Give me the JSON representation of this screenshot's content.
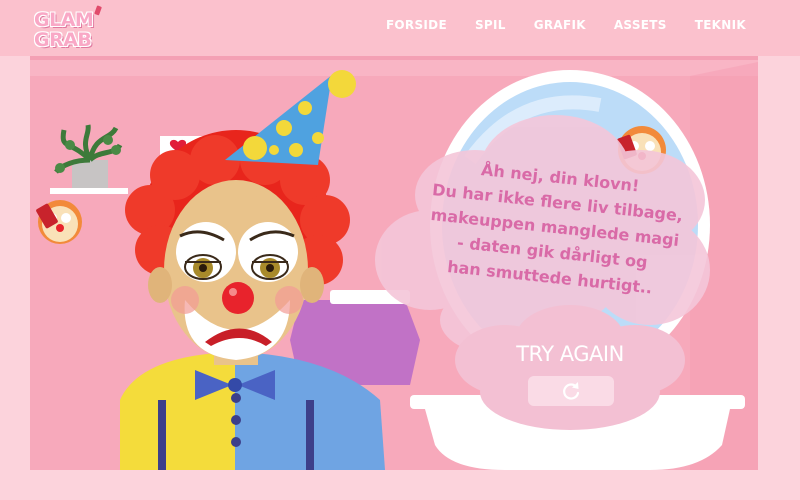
{
  "logo": {
    "line1": "GLAM",
    "line2": "GRAB"
  },
  "nav": {
    "items": [
      "FORSIDE",
      "SPIL",
      "GRAFIK",
      "ASSETS",
      "TEKNIK"
    ]
  },
  "game_over": {
    "message_lines": [
      "Åh nej, din klovn!",
      "Du har ikke flere liv tilbage,",
      "makeuppen manglede magi",
      "- daten gik dårligt og",
      "han smuttede hurtigt.."
    ],
    "try_again_label": "TRY AGAIN",
    "retry_icon": "refresh-icon"
  },
  "colors": {
    "header": "#fbc1cd",
    "room_wall": "#f7a9bb",
    "message_text": "#d96aa7",
    "clown_hair": "#e8251c",
    "clown_nose": "#e8232c",
    "hat_blue": "#4fa2e0",
    "hat_dots": "#f3d83a"
  }
}
